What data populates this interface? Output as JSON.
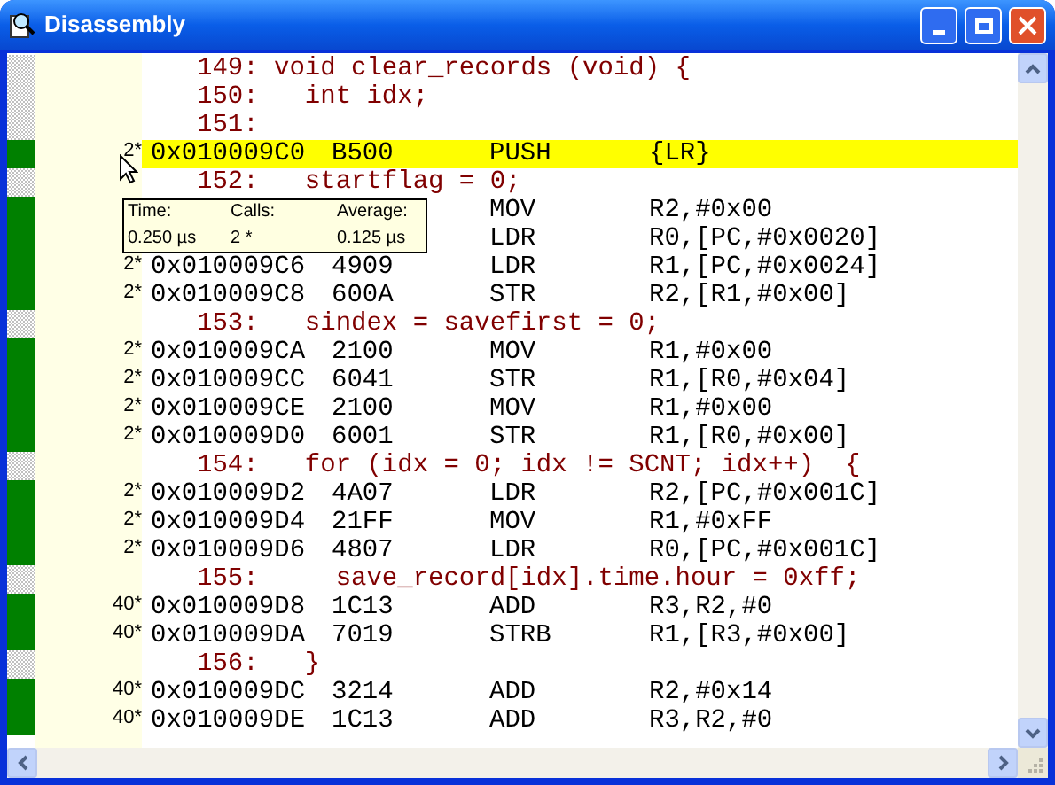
{
  "window": {
    "title": "Disassembly"
  },
  "lines": [
    {
      "kind": "source",
      "text": "149: void clear_records (void) {"
    },
    {
      "kind": "source",
      "text": "150:   int idx;"
    },
    {
      "kind": "source",
      "text": "151:"
    },
    {
      "kind": "asm",
      "count": "2*",
      "address": "0x010009C0",
      "opcode": "B500",
      "mnemonic": "PUSH",
      "operands": "{LR}",
      "selected": true
    },
    {
      "kind": "source",
      "text": "152:   startflag = 0;"
    },
    {
      "kind": "asm",
      "mnemonic": "MOV",
      "operands": "R2,#0x00",
      "selected": false
    },
    {
      "kind": "asm",
      "mnemonic": "LDR",
      "operands": "R0,[PC,#0x0020]",
      "selected": false
    },
    {
      "kind": "asm",
      "count": "2*",
      "address": "0x010009C6",
      "opcode": "4909",
      "mnemonic": "LDR",
      "operands": "R1,[PC,#0x0024]",
      "selected": false
    },
    {
      "kind": "asm",
      "count": "2*",
      "address": "0x010009C8",
      "opcode": "600A",
      "mnemonic": "STR",
      "operands": "R2,[R1,#0x00]",
      "selected": false
    },
    {
      "kind": "source",
      "text": "153:   sindex = savefirst = 0;"
    },
    {
      "kind": "asm",
      "count": "2*",
      "address": "0x010009CA",
      "opcode": "2100",
      "mnemonic": "MOV",
      "operands": "R1,#0x00",
      "selected": false
    },
    {
      "kind": "asm",
      "count": "2*",
      "address": "0x010009CC",
      "opcode": "6041",
      "mnemonic": "STR",
      "operands": "R1,[R0,#0x04]",
      "selected": false
    },
    {
      "kind": "asm",
      "count": "2*",
      "address": "0x010009CE",
      "opcode": "2100",
      "mnemonic": "MOV",
      "operands": "R1,#0x00",
      "selected": false
    },
    {
      "kind": "asm",
      "count": "2*",
      "address": "0x010009D0",
      "opcode": "6001",
      "mnemonic": "STR",
      "operands": "R1,[R0,#0x00]",
      "selected": false
    },
    {
      "kind": "source",
      "text": "154:   for (idx = 0; idx != SCNT; idx++)  {"
    },
    {
      "kind": "asm",
      "count": "2*",
      "address": "0x010009D2",
      "opcode": "4A07",
      "mnemonic": "LDR",
      "operands": "R2,[PC,#0x001C]",
      "selected": false
    },
    {
      "kind": "asm",
      "count": "2*",
      "address": "0x010009D4",
      "opcode": "21FF",
      "mnemonic": "MOV",
      "operands": "R1,#0xFF",
      "selected": false
    },
    {
      "kind": "asm",
      "count": "2*",
      "address": "0x010009D6",
      "opcode": "4807",
      "mnemonic": "LDR",
      "operands": "R0,[PC,#0x001C]",
      "selected": false
    },
    {
      "kind": "source",
      "text": "155:     save_record[idx].time.hour = 0xff;"
    },
    {
      "kind": "asm",
      "count": "40*",
      "address": "0x010009D8",
      "opcode": "1C13",
      "mnemonic": "ADD",
      "operands": "R3,R2,#0",
      "selected": false
    },
    {
      "kind": "asm",
      "count": "40*",
      "address": "0x010009DA",
      "opcode": "7019",
      "mnemonic": "STRB",
      "operands": "R1,[R3,#0x00]",
      "selected": false
    },
    {
      "kind": "source",
      "text": "156:   }"
    },
    {
      "kind": "asm",
      "count": "40*",
      "address": "0x010009DC",
      "opcode": "3214",
      "mnemonic": "ADD",
      "operands": "R2,#0x14",
      "selected": false
    },
    {
      "kind": "asm",
      "count": "40*",
      "address": "0x010009DE",
      "opcode": "1C13",
      "mnemonic": "ADD",
      "operands": "R3,R2,#0",
      "selected": false
    }
  ],
  "tooltip": {
    "labels": [
      "Time:",
      "Calls:",
      "Average:"
    ],
    "values": [
      "0.250 µs",
      "2 *",
      "0.125 µs"
    ]
  }
}
